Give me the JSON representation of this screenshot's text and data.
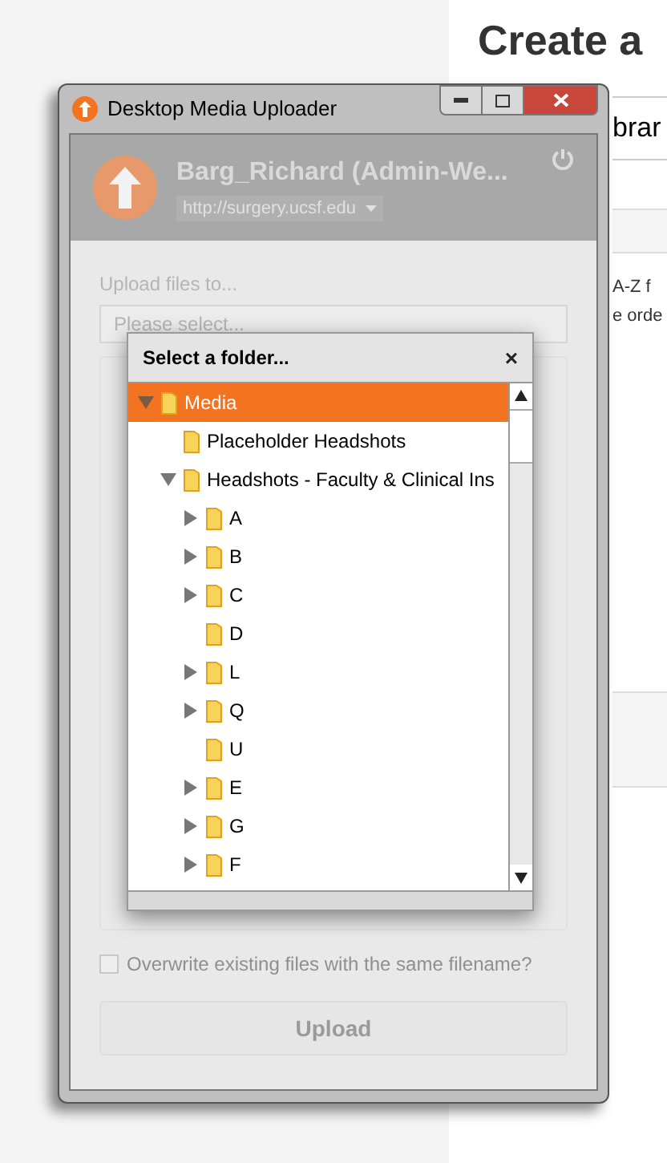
{
  "page": {
    "heading": "Create a",
    "field_text": "brar",
    "text_lines": [
      "A-Z f",
      "e orde"
    ]
  },
  "window": {
    "title": "Desktop Media Uploader",
    "account": {
      "name": "Barg_Richard (Admin-We...",
      "site": "http://surgery.ucsf.edu"
    },
    "upload_label": "Upload files to...",
    "folder_field": {
      "placeholder": "Please select..."
    },
    "overwrite": {
      "label": "Overwrite existing files with the same filename?",
      "checked": false
    },
    "upload_button": "Upload"
  },
  "dialog": {
    "title": "Select a folder...",
    "close": "×",
    "tree": [
      {
        "label": "Media",
        "expanded": true,
        "selected": true,
        "children": [
          {
            "label": "Placeholder Headshots",
            "selected": false
          },
          {
            "label": "Headshots - Faculty & Clinical Ins",
            "expanded": true,
            "selected": false,
            "children": [
              {
                "label": "A",
                "expanded": false,
                "selected": false
              },
              {
                "label": "B",
                "expanded": false,
                "selected": false
              },
              {
                "label": "C",
                "expanded": false,
                "selected": false
              },
              {
                "label": "D",
                "selected": false
              },
              {
                "label": "L",
                "expanded": false,
                "selected": false
              },
              {
                "label": "Q",
                "expanded": false,
                "selected": false
              },
              {
                "label": "U",
                "selected": false
              },
              {
                "label": "E",
                "expanded": false,
                "selected": false
              },
              {
                "label": "G",
                "expanded": false,
                "selected": false
              },
              {
                "label": "F",
                "expanded": false,
                "selected": false
              }
            ]
          }
        ]
      }
    ]
  }
}
